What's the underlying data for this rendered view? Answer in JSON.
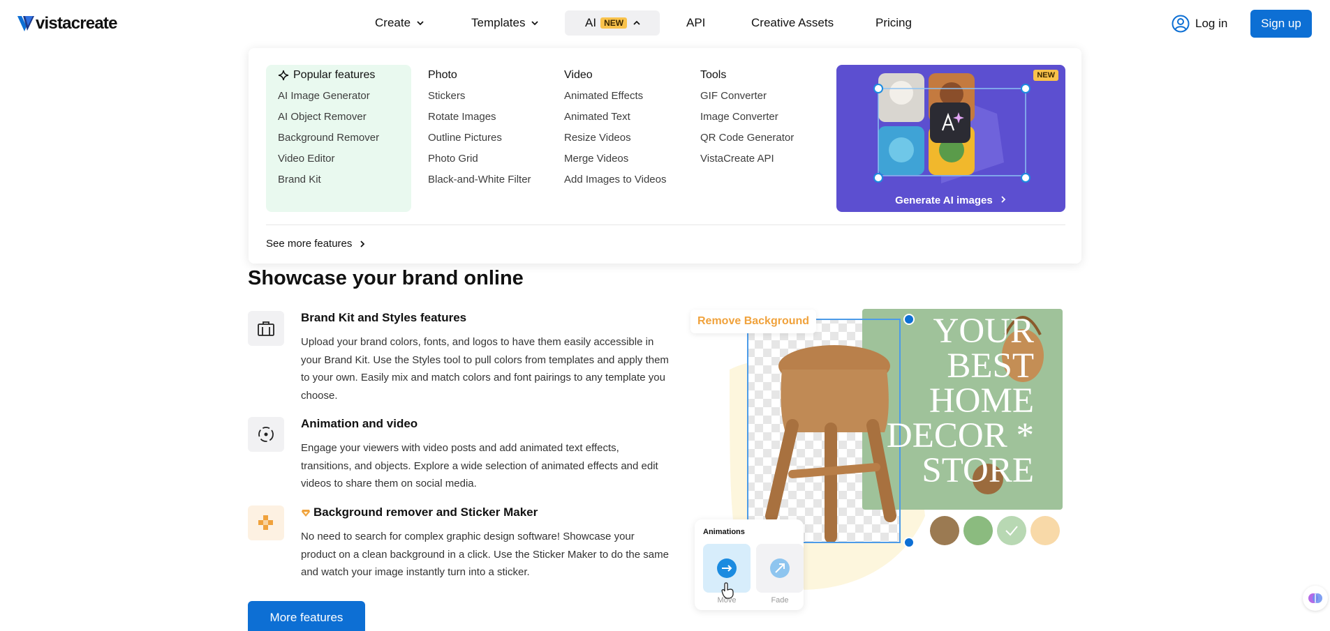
{
  "brand": {
    "name": "vistacreate",
    "accent": "#0d6fd4"
  },
  "nav": {
    "items": [
      {
        "label": "Create",
        "has_chevron": true
      },
      {
        "label": "Templates",
        "has_chevron": true
      },
      {
        "label": "AI",
        "badge": "NEW",
        "has_chevron": true,
        "expanded": true
      },
      {
        "label": "API"
      },
      {
        "label": "Creative Assets"
      },
      {
        "label": "Pricing"
      }
    ],
    "login_label": "Log in",
    "signup_label": "Sign up"
  },
  "dropdown": {
    "columns": [
      {
        "title": "Popular features",
        "links": [
          "AI Image Generator",
          "AI Object Remover",
          "Background Remover",
          "Video Editor",
          "Brand Kit"
        ]
      },
      {
        "title": "Photo",
        "links": [
          "Stickers",
          "Rotate Images",
          "Outline Pictures",
          "Photo Grid",
          "Black-and-White Filter"
        ]
      },
      {
        "title": "Video",
        "links": [
          "Animated Effects",
          "Animated Text",
          "Resize Videos",
          "Merge Videos",
          "Add Images to Videos"
        ]
      },
      {
        "title": "Tools",
        "links": [
          "GIF Converter",
          "Image Converter",
          "QR Code Generator",
          "VistaCreate API"
        ]
      }
    ],
    "promo": {
      "badge": "NEW",
      "cta": "Generate AI images"
    },
    "see_more": "See more features"
  },
  "main": {
    "title": "Showcase your brand online",
    "features": [
      {
        "icon": "briefcase-icon",
        "title": "Brand Kit and Styles features",
        "desc": "Upload your brand colors, fonts, and logos to have them easily accessible in your Brand Kit. Use the Styles tool to pull colors from templates and apply them to your own. Easily mix and match colors and font pairings to any template you choose."
      },
      {
        "icon": "animation-icon",
        "title": "Animation and video",
        "desc": "Engage your viewers with video posts and add animated text effects, transitions, and objects. Explore a wide selection of animated effects and edit videos to share them on social media."
      },
      {
        "icon": "checker-icon",
        "title": "Background remover and Sticker Maker",
        "desc": "No need to search for complex graphic design software! Showcase your product on a clean background in a click. Use the Sticker Maker to do the same and watch your image instantly turn into a sticker."
      }
    ],
    "more_button": "More features"
  },
  "illustration": {
    "remove_bg_label": "Remove Background",
    "poster_lines": [
      "YOUR",
      "BEST",
      "HOME",
      "DECOR *",
      "STORE"
    ],
    "swatches": [
      "#9b7a52",
      "#8bbb7f",
      "#b8d8b3",
      "#f8d9a8"
    ],
    "animations_title": "Animations",
    "anim_options": [
      "Move",
      "Fade"
    ]
  }
}
